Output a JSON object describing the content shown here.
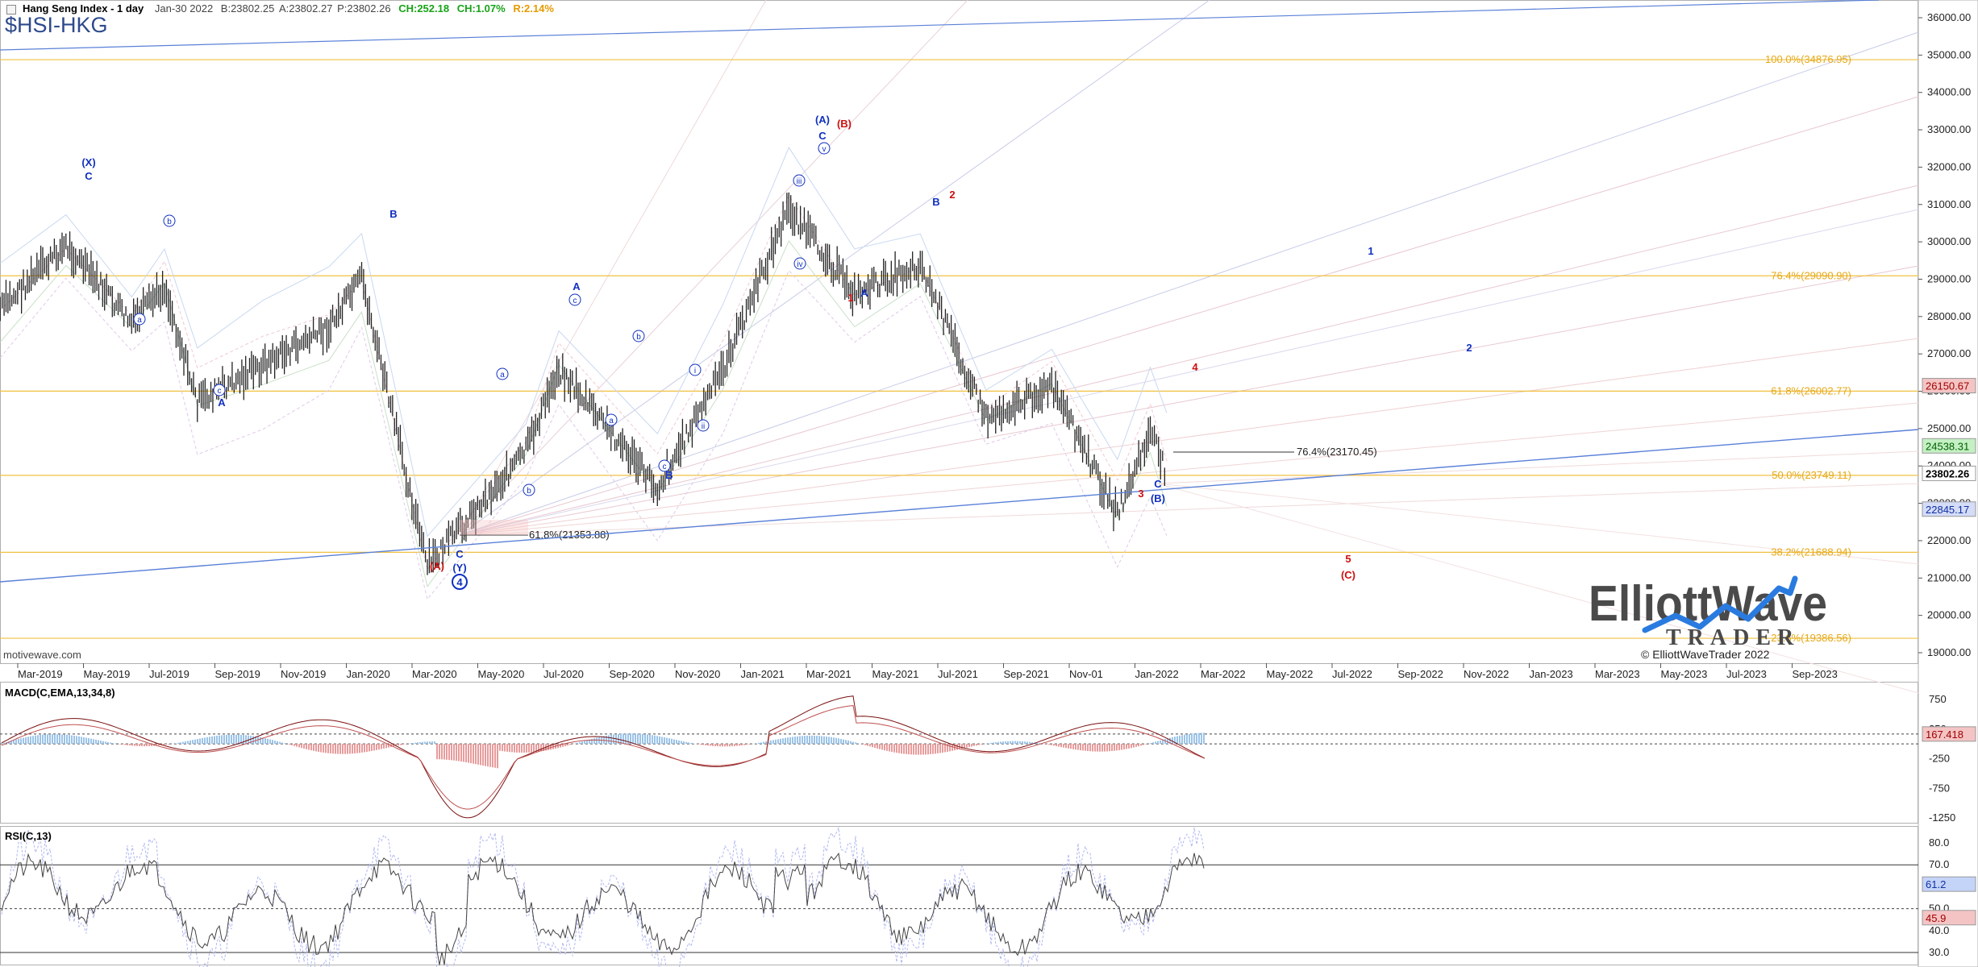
{
  "header": {
    "title": "Hang Seng Index - 1 day",
    "date": "Jan-30 2022",
    "bid": "B:23802.25",
    "ask": "A:23802.27",
    "price": "P:23802.26",
    "change_abs": "CH:252.18",
    "change_pct": "CH:1.07%",
    "range_pct": "R:2.14%",
    "ticker": "$HSI-HKG"
  },
  "colors": {
    "up": "#17a317",
    "range": "#e69b00",
    "blue_wave": "#1030c0",
    "red_wave": "#cc1010",
    "fib": "#f0c040",
    "trendline": "#5a80d8"
  },
  "price_axis": {
    "ticks": [
      "36000.00",
      "35000.00",
      "34000.00",
      "33000.00",
      "32000.00",
      "31000.00",
      "30000.00",
      "29000.00",
      "28000.00",
      "27000.00",
      "26000.00",
      "25000.00",
      "24000.00",
      "23000.00",
      "22000.00",
      "21000.00",
      "20000.00",
      "19000.00"
    ],
    "badges": [
      {
        "label": "26150.67",
        "kind": "red"
      },
      {
        "label": "24538.31",
        "kind": "green"
      },
      {
        "label": "23802.26",
        "kind": "current"
      },
      {
        "label": "22845.17",
        "kind": "blue"
      }
    ]
  },
  "date_axis": [
    "Mar-2019",
    "May-2019",
    "Jul-2019",
    "Sep-2019",
    "Nov-2019",
    "Jan-2020",
    "Mar-2020",
    "May-2020",
    "Jul-2020",
    "Sep-2020",
    "Nov-2020",
    "Jan-2021",
    "Mar-2021",
    "May-2021",
    "Jul-2021",
    "Sep-2021",
    "Nov-01",
    "Jan-2022",
    "Mar-2022",
    "May-2022",
    "Jul-2022",
    "Sep-2022",
    "Nov-2022",
    "Jan-2023",
    "Mar-2023",
    "May-2023",
    "Jul-2023",
    "Sep-2023"
  ],
  "fib_levels": [
    {
      "label": "100.0%(34876.95)",
      "value": 34876.95
    },
    {
      "label": "76.4%(29090.90)",
      "value": 29090.9
    },
    {
      "label": "61.8%(26002.77)",
      "value": 26002.77
    },
    {
      "label": "50.0%(23749.11)",
      "value": 23749.11
    },
    {
      "label": "38.2%(21688.94)",
      "value": 21688.94
    },
    {
      "label": "23.6%(19386.56)",
      "value": 19386.56
    }
  ],
  "annotations": {
    "retrace_low": "61.8%(21353.88)",
    "retrace_high": "76.4%(23170.45)"
  },
  "wave_labels": [
    {
      "text": "(X)",
      "color": "blue"
    },
    {
      "text": "C",
      "color": "blue"
    },
    {
      "text": "a",
      "color": "blue"
    },
    {
      "text": "b",
      "color": "blue"
    },
    {
      "text": "c",
      "color": "blue"
    },
    {
      "text": "A",
      "color": "blue"
    },
    {
      "text": "B",
      "color": "blue"
    },
    {
      "text": "(A)",
      "color": "red"
    },
    {
      "text": "C",
      "color": "blue"
    },
    {
      "text": "(Y)",
      "color": "blue"
    },
    {
      "text": "4",
      "color": "blue"
    },
    {
      "text": "a",
      "color": "blue"
    },
    {
      "text": "b",
      "color": "blue"
    },
    {
      "text": "A",
      "color": "blue"
    },
    {
      "text": "c",
      "color": "blue"
    },
    {
      "text": "a",
      "color": "blue"
    },
    {
      "text": "b",
      "color": "blue"
    },
    {
      "text": "c",
      "color": "blue"
    },
    {
      "text": "B",
      "color": "blue"
    },
    {
      "text": "i",
      "color": "blue"
    },
    {
      "text": "ii",
      "color": "blue"
    },
    {
      "text": "iii",
      "color": "blue"
    },
    {
      "text": "iv",
      "color": "blue"
    },
    {
      "text": "v",
      "color": "blue"
    },
    {
      "text": "(A)",
      "color": "blue"
    },
    {
      "text": "C",
      "color": "blue"
    },
    {
      "text": "(B)",
      "color": "red"
    },
    {
      "text": "1",
      "color": "red"
    },
    {
      "text": "A",
      "color": "blue"
    },
    {
      "text": "B",
      "color": "blue"
    },
    {
      "text": "2",
      "color": "red"
    },
    {
      "text": "3",
      "color": "red"
    },
    {
      "text": "C",
      "color": "blue"
    },
    {
      "text": "(B)",
      "color": "blue"
    },
    {
      "text": "4",
      "color": "red"
    },
    {
      "text": "5",
      "color": "red"
    },
    {
      "text": "(C)",
      "color": "red"
    },
    {
      "text": "1",
      "color": "blue"
    },
    {
      "text": "2",
      "color": "blue"
    }
  ],
  "macd": {
    "title": "MACD(C,EMA,13,34,8)",
    "ticks": [
      "750",
      "250",
      "-250",
      "-750",
      "-1250"
    ],
    "badge": "167.418"
  },
  "rsi": {
    "title": "RSI(C,13)",
    "ticks": [
      "80.0",
      "70.0",
      "60.0",
      "50.0",
      "40.0",
      "30.0"
    ],
    "badges": [
      "61.2",
      "45.9"
    ]
  },
  "footer": {
    "watermark": "motivewave.com",
    "copyright": "© ElliottWaveTrader 2022",
    "logo_main": "ElliottWave",
    "logo_sub": "TRADER"
  },
  "chart_data": {
    "type": "candlestick",
    "title": "Hang Seng Index - 1 day",
    "ylim": [
      18800,
      36300
    ],
    "price_series_approx": [
      {
        "date": "2019-02",
        "close": 28200
      },
      {
        "date": "2019-04",
        "close": 29900
      },
      {
        "date": "2019-06",
        "close": 27800
      },
      {
        "date": "2019-07",
        "close": 28800
      },
      {
        "date": "2019-08",
        "close": 25700
      },
      {
        "date": "2019-10",
        "close": 26700
      },
      {
        "date": "2019-12",
        "close": 27700
      },
      {
        "date": "2020-01",
        "close": 29000
      },
      {
        "date": "2020-03",
        "close": 21300
      },
      {
        "date": "2020-06",
        "close": 24400
      },
      {
        "date": "2020-07",
        "close": 26600
      },
      {
        "date": "2020-10",
        "close": 23400
      },
      {
        "date": "2020-12",
        "close": 26600
      },
      {
        "date": "2021-02",
        "close": 30900
      },
      {
        "date": "2021-04",
        "close": 28600
      },
      {
        "date": "2021-06",
        "close": 29400
      },
      {
        "date": "2021-08",
        "close": 25300
      },
      {
        "date": "2021-10",
        "close": 26100
      },
      {
        "date": "2021-12",
        "close": 22700
      },
      {
        "date": "2022-01",
        "close": 24900
      },
      {
        "date": "2022-01-30",
        "close": 23802.26
      }
    ],
    "projections": [
      "1",
      "2",
      "5",
      "(C)"
    ]
  }
}
